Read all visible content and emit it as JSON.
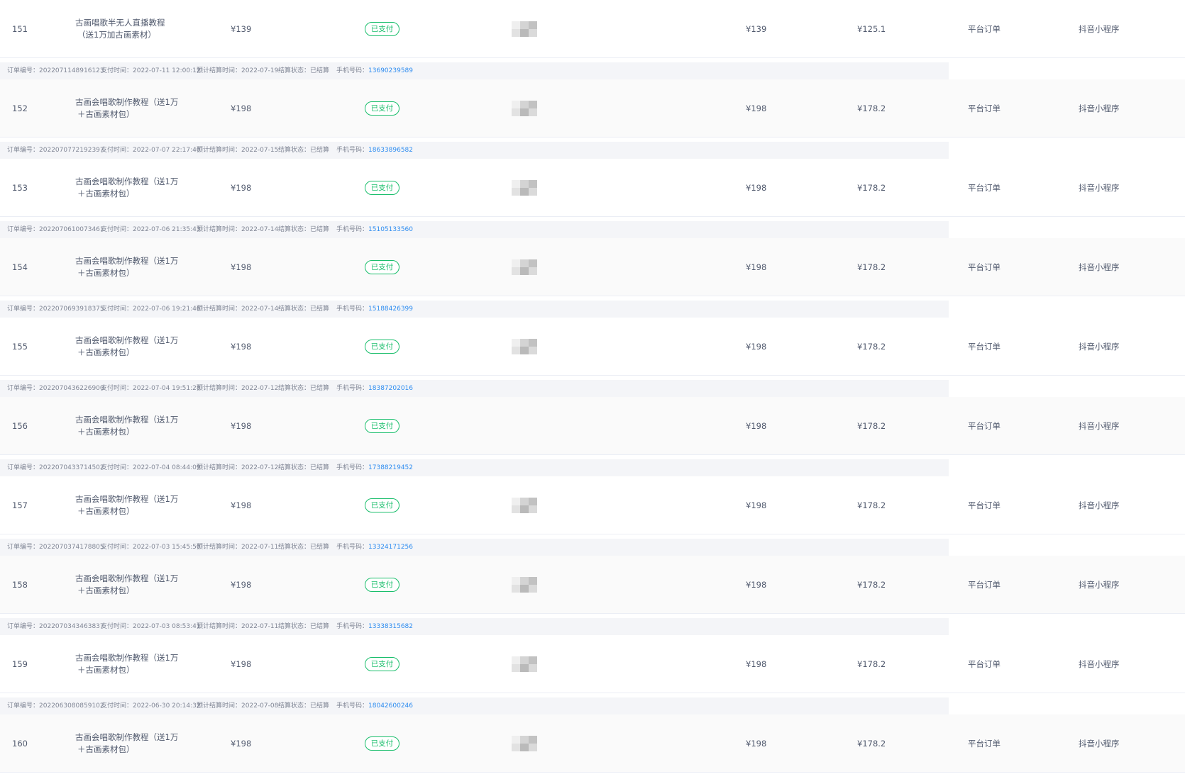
{
  "labels": {
    "order_no": "订单编号：",
    "pay_time": "支付时间：",
    "est_settle": "预计结算时间：",
    "settle_status": "结算状态：",
    "phone": "手机号码："
  },
  "colors": {
    "text": "#515a6e",
    "meta_text": "#808695",
    "link": "#2d8cf0",
    "status_green": "#19be6b",
    "meta_bg": "#f4f5f8"
  },
  "orders": [
    {
      "meta": null,
      "index": "151",
      "name_line1": "古画唱歌半无人直播教程",
      "name_line2": "（送1万加古画素材）",
      "price": "¥139",
      "status": "已支付",
      "buyer_masked": true,
      "pay_amount": "¥139",
      "settle_amount": "¥125.1",
      "order_type": "平台订单",
      "source": "抖音小程序"
    },
    {
      "meta": {
        "order_no": "2022071148916123",
        "pay_time": "2022-07-11 12:00:12",
        "est_settle": "2022-07-19",
        "settle_status": "已结算",
        "phone": "13690239589"
      },
      "index": "152",
      "name_line1": "古画会唱歌制作教程（送1万",
      "name_line2": "＋古画素材包）",
      "price": "¥198",
      "status": "已支付",
      "buyer_masked": true,
      "pay_amount": "¥198",
      "settle_amount": "¥178.2",
      "order_type": "平台订单",
      "source": "抖音小程序"
    },
    {
      "meta": {
        "order_no": "2022070772192397",
        "pay_time": "2022-07-07 22:17:40",
        "est_settle": "2022-07-15",
        "settle_status": "已结算",
        "phone": "18633896582"
      },
      "index": "153",
      "name_line1": "古画会唱歌制作教程（送1万",
      "name_line2": "＋古画素材包）",
      "price": "¥198",
      "status": "已支付",
      "buyer_masked": true,
      "pay_amount": "¥198",
      "settle_amount": "¥178.2",
      "order_type": "平台订单",
      "source": "抖音小程序"
    },
    {
      "meta": {
        "order_no": "2022070610073461",
        "pay_time": "2022-07-06 21:35:43",
        "est_settle": "2022-07-14",
        "settle_status": "已结算",
        "phone": "15105133560"
      },
      "index": "154",
      "name_line1": "古画会唱歌制作教程（送1万",
      "name_line2": "＋古画素材包）",
      "price": "¥198",
      "status": "已支付",
      "buyer_masked": true,
      "pay_amount": "¥198",
      "settle_amount": "¥178.2",
      "order_type": "平台订单",
      "source": "抖音小程序"
    },
    {
      "meta": {
        "order_no": "2022070693918375",
        "pay_time": "2022-07-06 19:21:46",
        "est_settle": "2022-07-14",
        "settle_status": "已结算",
        "phone": "15188426399"
      },
      "index": "155",
      "name_line1": "古画会唱歌制作教程（送1万",
      "name_line2": "＋古画素材包）",
      "price": "¥198",
      "status": "已支付",
      "buyer_masked": true,
      "pay_amount": "¥198",
      "settle_amount": "¥178.2",
      "order_type": "平台订单",
      "source": "抖音小程序"
    },
    {
      "meta": {
        "order_no": "2022070436226900",
        "pay_time": "2022-07-04 19:51:28",
        "est_settle": "2022-07-12",
        "settle_status": "已结算",
        "phone": "18387202016"
      },
      "index": "156",
      "name_line1": "古画会唱歌制作教程（送1万",
      "name_line2": "＋古画素材包）",
      "price": "¥198",
      "status": "已支付",
      "buyer_masked": false,
      "pay_amount": "¥198",
      "settle_amount": "¥178.2",
      "order_type": "平台订单",
      "source": "抖音小程序"
    },
    {
      "meta": {
        "order_no": "2022070433714502",
        "pay_time": "2022-07-04 08:44:09",
        "est_settle": "2022-07-12",
        "settle_status": "已结算",
        "phone": "17388219452"
      },
      "index": "157",
      "name_line1": "古画会唱歌制作教程（送1万",
      "name_line2": "＋古画素材包）",
      "price": "¥198",
      "status": "已支付",
      "buyer_masked": true,
      "pay_amount": "¥198",
      "settle_amount": "¥178.2",
      "order_type": "平台订单",
      "source": "抖音小程序"
    },
    {
      "meta": {
        "order_no": "2022070374178805",
        "pay_time": "2022-07-03 15:45:50",
        "est_settle": "2022-07-11",
        "settle_status": "已结算",
        "phone": "13324171256"
      },
      "index": "158",
      "name_line1": "古画会唱歌制作教程（送1万",
      "name_line2": "＋古画素材包）",
      "price": "¥198",
      "status": "已支付",
      "buyer_masked": true,
      "pay_amount": "¥198",
      "settle_amount": "¥178.2",
      "order_type": "平台订单",
      "source": "抖音小程序"
    },
    {
      "meta": {
        "order_no": "2022070343463837",
        "pay_time": "2022-07-03 08:53:41",
        "est_settle": "2022-07-11",
        "settle_status": "已结算",
        "phone": "13338315682"
      },
      "index": "159",
      "name_line1": "古画会唱歌制作教程（送1万",
      "name_line2": "＋古画素材包）",
      "price": "¥198",
      "status": "已支付",
      "buyer_masked": true,
      "pay_amount": "¥198",
      "settle_amount": "¥178.2",
      "order_type": "平台订单",
      "source": "抖音小程序"
    },
    {
      "meta": {
        "order_no": "2022063080859102",
        "pay_time": "2022-06-30 20:14:32",
        "est_settle": "2022-07-08",
        "settle_status": "已结算",
        "phone": "18042600246"
      },
      "index": "160",
      "name_line1": "古画会唱歌制作教程（送1万",
      "name_line2": "＋古画素材包）",
      "price": "¥198",
      "status": "已支付",
      "buyer_masked": true,
      "pay_amount": "¥198",
      "settle_amount": "¥178.2",
      "order_type": "平台订单",
      "source": "抖音小程序"
    }
  ]
}
